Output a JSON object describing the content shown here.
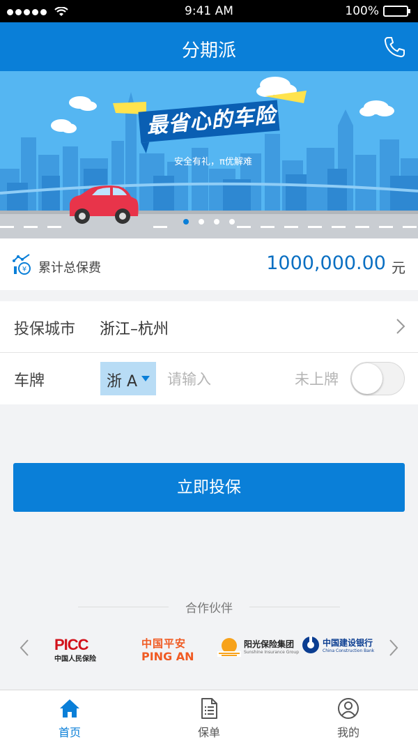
{
  "status_bar": {
    "time": "9:41 AM",
    "battery": "100%"
  },
  "header": {
    "title": "分期派",
    "phone_icon": "phone-icon"
  },
  "banner": {
    "headline": "最省心的车险",
    "subline": "安全有礼，π优解难",
    "slide_count": 4,
    "active_slide": 1
  },
  "premium": {
    "label": "累计总保费",
    "amount": "1000,000.00",
    "unit": "元"
  },
  "form": {
    "city_label": "投保城市",
    "city_value": "浙江–杭州",
    "plate_label": "车牌",
    "plate_prefix": "浙 A",
    "plate_placeholder": "请输入",
    "unregistered_label": "未上牌",
    "unregistered_toggle": false
  },
  "submit_label": "立即投保",
  "partners": {
    "title": "合作伙伴",
    "logos": {
      "picc": {
        "name": "PICC",
        "sub": "中国人民保险"
      },
      "pingan": {
        "zh": "中国平安",
        "en": "PING AN"
      },
      "sunshine": {
        "zh": "阳光保险集团",
        "en": "Sunshine Insurance Group"
      },
      "ccb": {
        "zh": "中国建设银行",
        "en": "China Construction Bank"
      }
    }
  },
  "tabs": [
    {
      "label": "首页",
      "icon": "home-icon",
      "active": true
    },
    {
      "label": "保单",
      "icon": "document-icon",
      "active": false
    },
    {
      "label": "我的",
      "icon": "user-icon",
      "active": false
    }
  ],
  "colors": {
    "primary": "#0a7fd8",
    "amount": "#0a6fc2",
    "banner_sky": "#55b6f2",
    "car": "#e8344a"
  }
}
